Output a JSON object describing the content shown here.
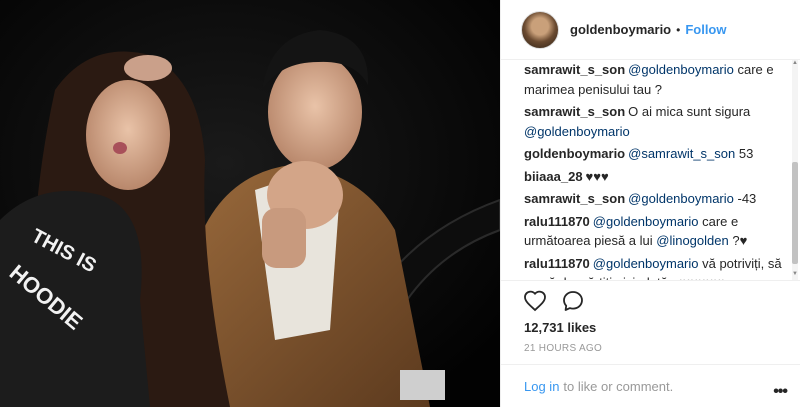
{
  "post": {
    "username": "goldenboymario",
    "separator": "•",
    "follow_label": "Follow",
    "photo_text": "THIS IS MY HOODIE"
  },
  "comments": [
    {
      "user": "samrawit_s_son",
      "parts": [
        {
          "mention": "@goldenboymario"
        },
        {
          "text": " care e marimea penisului tau ?"
        }
      ]
    },
    {
      "user": "samrawit_s_son",
      "parts": [
        {
          "text": "O ai mica sunt sigura "
        },
        {
          "mention": "@goldenboymario"
        }
      ]
    },
    {
      "user": "goldenboymario",
      "parts": [
        {
          "mention": "@samrawit_s_son"
        },
        {
          "text": " 53"
        }
      ]
    },
    {
      "user": "biiaaa_28",
      "parts": [
        {
          "text": "♥♥♥"
        }
      ]
    },
    {
      "user": "samrawit_s_son",
      "parts": [
        {
          "mention": "@goldenboymario"
        },
        {
          "text": " -43"
        }
      ]
    },
    {
      "user": "ralu111870",
      "parts": [
        {
          "mention": "@goldenboymario"
        },
        {
          "text": " care e următoarea piesă a lui "
        },
        {
          "mention": "@linogolden"
        },
        {
          "text": " ?♥"
        }
      ]
    },
    {
      "user": "ralu111870",
      "parts": [
        {
          "mention": "@goldenboymario"
        },
        {
          "text": " vă potriviți, să nu vă despărțiți niciodată...♥♥♥♥♥♥"
        }
      ]
    }
  ],
  "actions": {
    "likes": "12,731 likes",
    "time": "21 HOURS AGO",
    "login_link": "Log in",
    "login_suffix": "to like or comment.",
    "more_label": "•••"
  },
  "icons": {
    "like": "heart-icon",
    "comment": "speech-bubble-icon",
    "more": "more-options-icon"
  },
  "colors": {
    "link": "#3897f0",
    "mention": "#003569",
    "muted": "#999999",
    "text": "#262626"
  }
}
